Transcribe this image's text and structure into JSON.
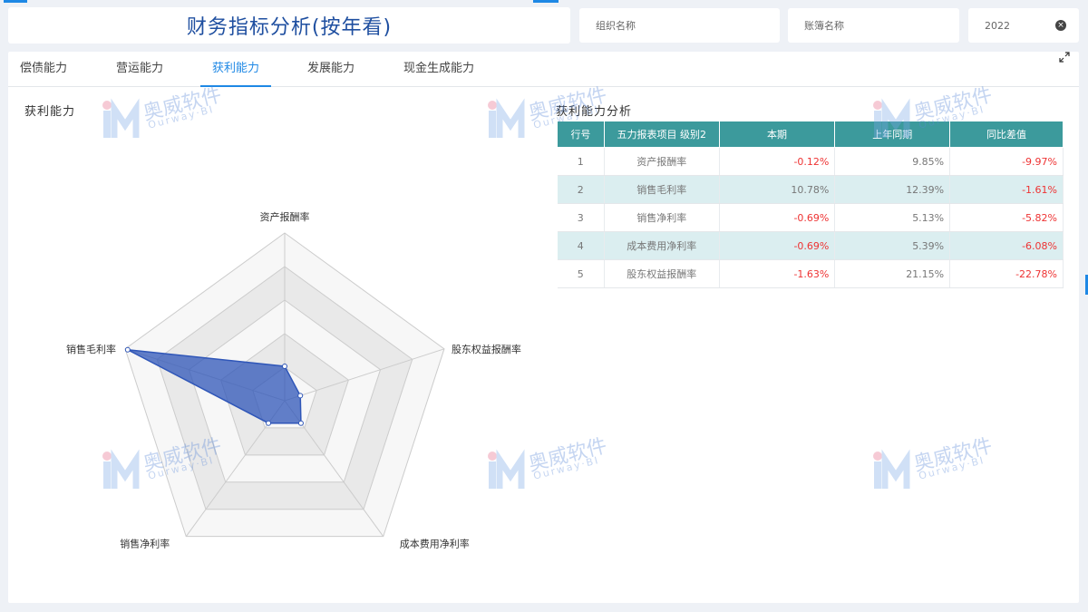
{
  "header": {
    "title": "财务指标分析(按年看)",
    "org_placeholder": "组织名称",
    "book_placeholder": "账簿名称",
    "year_value": "2022",
    "clear_glyph": "×"
  },
  "tabs": [
    {
      "label": "偿债能力",
      "active": false
    },
    {
      "label": "营运能力",
      "active": false
    },
    {
      "label": "获利能力",
      "active": true
    },
    {
      "label": "发展能力",
      "active": false
    },
    {
      "label": "现金生成能力",
      "active": false
    }
  ],
  "expand_icon": "expand-icon",
  "radar_section": {
    "title": "获利能力"
  },
  "chart_data": {
    "type": "radar",
    "indicators": [
      "资产报酬率",
      "股东权益报酬率",
      "成本费用净利率",
      "销售净利率",
      "销售毛利率"
    ],
    "series": [
      {
        "values": [
          -0.12,
          -1.63,
          -0.69,
          -0.69,
          10.78
        ]
      }
    ],
    "range": [
      -3,
      11
    ],
    "colors": {
      "series": "#2f56b8",
      "band_a": "#f7f7f7",
      "band_b": "#e9e9e9",
      "axis": "#cccccc"
    }
  },
  "table_section": {
    "title": "获利能力分析",
    "headers": [
      "行号",
      "五力报表项目 级别2",
      "本期",
      "上年同期",
      "同比差值"
    ],
    "rows": [
      {
        "no": "1",
        "item": "资产报酬率",
        "current": "-0.12%",
        "prior": "9.85%",
        "diff": "-9.97%"
      },
      {
        "no": "2",
        "item": "销售毛利率",
        "current": "10.78%",
        "prior": "12.39%",
        "diff": "-1.61%"
      },
      {
        "no": "3",
        "item": "销售净利率",
        "current": "-0.69%",
        "prior": "5.13%",
        "diff": "-5.82%"
      },
      {
        "no": "4",
        "item": "成本费用净利率",
        "current": "-0.69%",
        "prior": "5.39%",
        "diff": "-6.08%"
      },
      {
        "no": "5",
        "item": "股东权益报酬率",
        "current": "-1.63%",
        "prior": "21.15%",
        "diff": "-22.78%"
      }
    ]
  },
  "watermark": {
    "cn": "奥威软件",
    "en": "Ourway·BI"
  },
  "colors": {
    "accent": "#1e88e5",
    "title": "#1f4fa0",
    "table_header": "#3c9a9c",
    "negative": "#e33333"
  }
}
